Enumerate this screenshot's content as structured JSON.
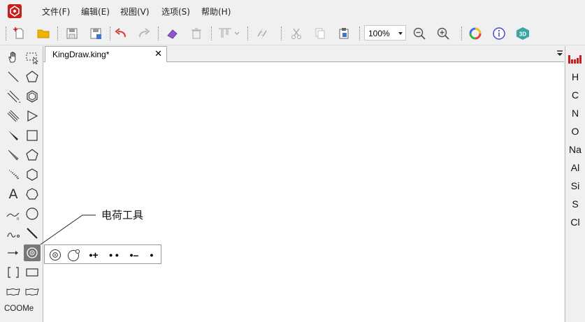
{
  "menu": {
    "file": "文件(F)",
    "edit": "编辑(E)",
    "view": "视图(V)",
    "options": "选项(S)",
    "help": "帮助(H)"
  },
  "toolbar": {
    "zoom_value": "100%"
  },
  "tab": {
    "title": "KingDraw.king*",
    "close": "✕"
  },
  "left_tools": {
    "text_tool": "A",
    "template_label": "COOMe"
  },
  "flyout": {
    "positive_charge": "•+",
    "radical_pair": "• •",
    "negative_charge": "•–",
    "single_radical": "•"
  },
  "callout": {
    "label": "电荷工具"
  },
  "periodic": {
    "elements": [
      "H",
      "C",
      "N",
      "O",
      "Na",
      "Al",
      "Si",
      "S",
      "Cl"
    ]
  },
  "colors": {
    "brand_red": "#c81e1e",
    "undo_red": "#d23c3c",
    "folder_yellow": "#f0b400",
    "eraser_purple": "#8c5ac8",
    "info_blue": "#4a4ad0",
    "teal_3d": "#3aa6a6"
  }
}
